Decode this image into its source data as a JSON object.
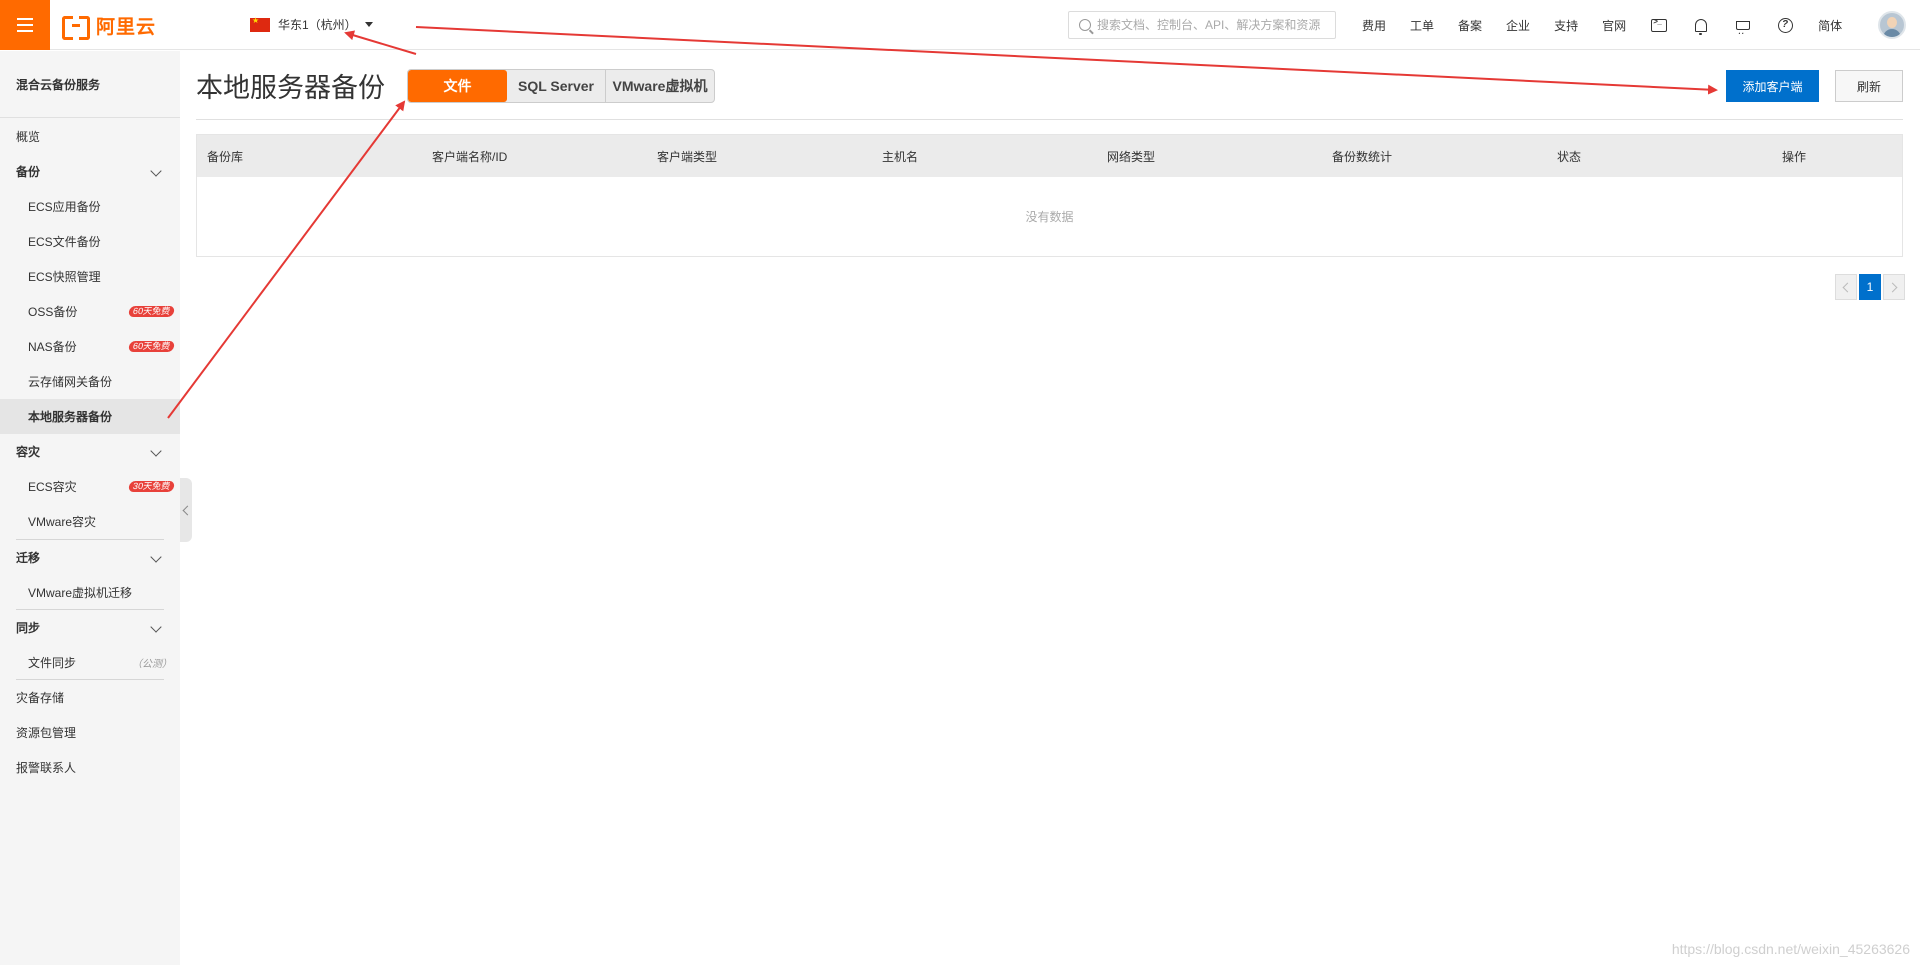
{
  "topbar": {
    "logo_text": "阿里云",
    "region": "华东1（杭州）",
    "search_placeholder": "搜索文档、控制台、API、解决方案和资源",
    "nav": [
      "费用",
      "工单",
      "备案",
      "企业",
      "支持",
      "官网"
    ],
    "lang": "简体"
  },
  "sidebar": {
    "title": "混合云备份服务",
    "overview": "概览",
    "groups": {
      "backup": "备份",
      "disaster": "容灾",
      "migrate": "迁移",
      "sync": "同步"
    },
    "items": {
      "ecs_app": "ECS应用备份",
      "ecs_file": "ECS文件备份",
      "ecs_snapshot": "ECS快照管理",
      "oss": "OSS备份",
      "nas": "NAS备份",
      "csg": "云存储网关备份",
      "local": "本地服务器备份",
      "ecs_dr": "ECS容灾",
      "vmware_dr": "VMware容灾",
      "vmware_migrate": "VMware虚拟机迁移",
      "file_sync": "文件同步",
      "dr_storage": "灾备存储",
      "pkg": "资源包管理",
      "contacts": "报警联系人"
    },
    "badges": {
      "oss": "60天免费",
      "nas": "60天免费",
      "ecs_dr": "30天免费"
    },
    "file_sync_note": "（公测）"
  },
  "main": {
    "title": "本地服务器备份",
    "tabs": [
      "文件",
      "SQL Server",
      "VMware虚拟机"
    ],
    "add_client": "添加客户端",
    "refresh": "刷新",
    "columns": [
      "备份库",
      "客户端名称/ID",
      "客户端类型",
      "主机名",
      "网络类型",
      "备份数统计",
      "状态",
      "操作"
    ],
    "empty_text": "没有数据",
    "current_page": "1"
  },
  "watermark": "https://blog.csdn.net/weixin_45263626",
  "colors": {
    "brand_orange": "#ff6a00",
    "primary_blue": "#0070cc",
    "annotation_red": "#e53935"
  }
}
